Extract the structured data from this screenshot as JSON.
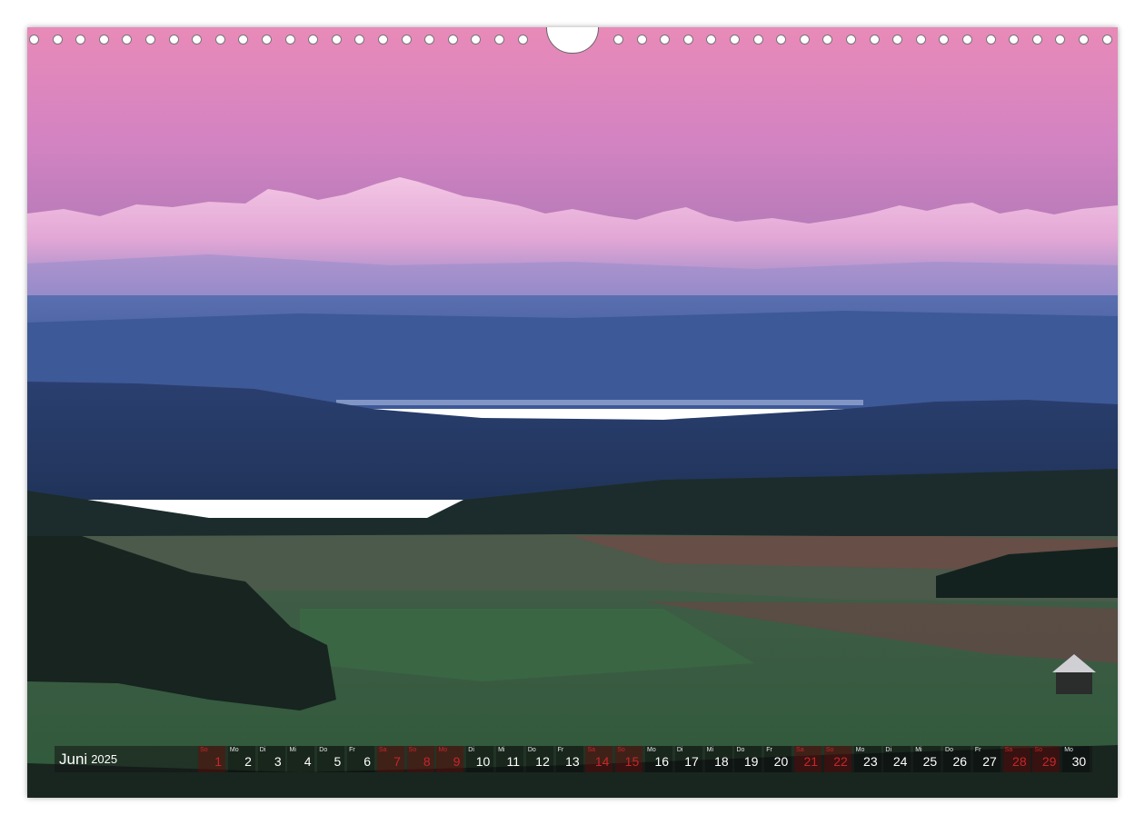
{
  "calendar": {
    "month": "Juni",
    "year": "2025",
    "days": [
      {
        "num": "1",
        "abbr": "So",
        "weekend": true
      },
      {
        "num": "2",
        "abbr": "Mo",
        "weekend": false
      },
      {
        "num": "3",
        "abbr": "Di",
        "weekend": false
      },
      {
        "num": "4",
        "abbr": "Mi",
        "weekend": false
      },
      {
        "num": "5",
        "abbr": "Do",
        "weekend": false
      },
      {
        "num": "6",
        "abbr": "Fr",
        "weekend": false
      },
      {
        "num": "7",
        "abbr": "Sa",
        "weekend": true
      },
      {
        "num": "8",
        "abbr": "So",
        "weekend": true
      },
      {
        "num": "9",
        "abbr": "Mo",
        "weekend": true
      },
      {
        "num": "10",
        "abbr": "Di",
        "weekend": false
      },
      {
        "num": "11",
        "abbr": "Mi",
        "weekend": false
      },
      {
        "num": "12",
        "abbr": "Do",
        "weekend": false
      },
      {
        "num": "13",
        "abbr": "Fr",
        "weekend": false
      },
      {
        "num": "14",
        "abbr": "Sa",
        "weekend": true
      },
      {
        "num": "15",
        "abbr": "So",
        "weekend": true
      },
      {
        "num": "16",
        "abbr": "Mo",
        "weekend": false
      },
      {
        "num": "17",
        "abbr": "Di",
        "weekend": false
      },
      {
        "num": "18",
        "abbr": "Mi",
        "weekend": false
      },
      {
        "num": "19",
        "abbr": "Do",
        "weekend": false
      },
      {
        "num": "20",
        "abbr": "Fr",
        "weekend": false
      },
      {
        "num": "21",
        "abbr": "Sa",
        "weekend": true
      },
      {
        "num": "22",
        "abbr": "So",
        "weekend": true
      },
      {
        "num": "23",
        "abbr": "Mo",
        "weekend": false
      },
      {
        "num": "24",
        "abbr": "Di",
        "weekend": false
      },
      {
        "num": "25",
        "abbr": "Mi",
        "weekend": false
      },
      {
        "num": "26",
        "abbr": "Do",
        "weekend": false
      },
      {
        "num": "27",
        "abbr": "Fr",
        "weekend": false
      },
      {
        "num": "28",
        "abbr": "Sa",
        "weekend": true
      },
      {
        "num": "29",
        "abbr": "So",
        "weekend": true
      },
      {
        "num": "30",
        "abbr": "Mo",
        "weekend": false
      }
    ]
  },
  "colors": {
    "sky_top": "#e889b8",
    "sky_bottom": "#c47ab8",
    "mountains": "#e6b3d6",
    "weekend": "#c8262a"
  }
}
